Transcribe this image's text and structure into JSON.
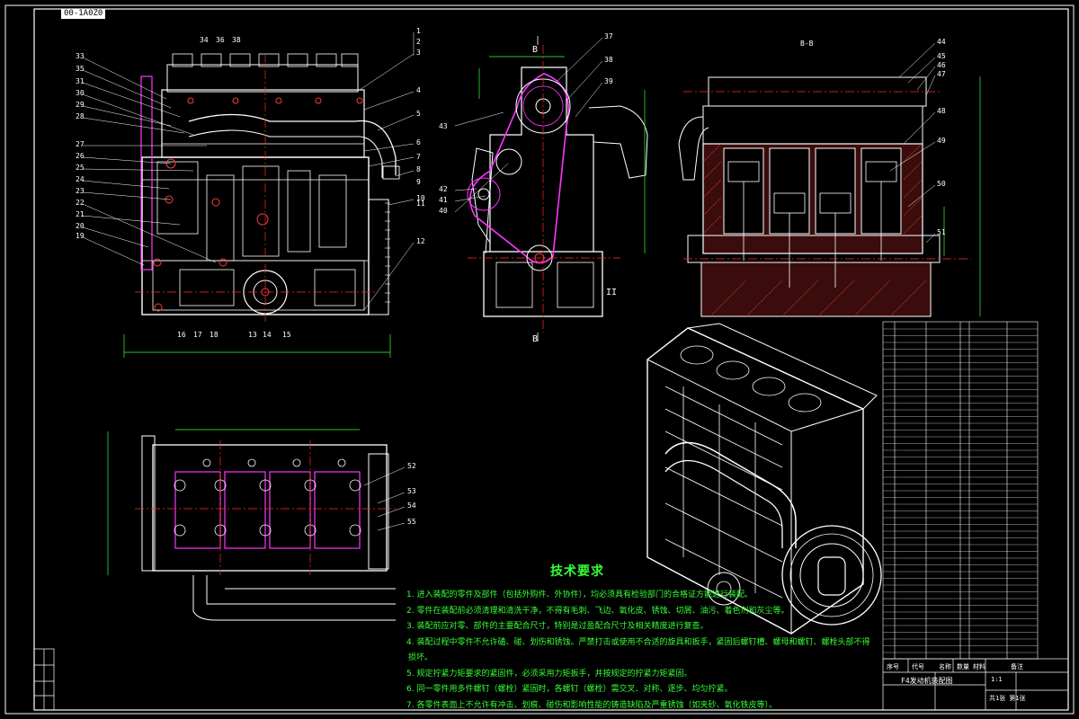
{
  "drawing_stamp": "00-1A0Z0",
  "section_label": "B-B",
  "view_markers": {
    "b_top": "B",
    "b_bottom": "B",
    "side_mark": "II"
  },
  "front_view_callouts_left": [
    "33",
    "35",
    "31",
    "30",
    "29",
    "28",
    "27",
    "26",
    "25",
    "24",
    "23",
    "22",
    "21",
    "20",
    "19"
  ],
  "front_view_callouts_top": [
    "34",
    "36",
    "38"
  ],
  "front_view_callouts_right": [
    "1",
    "2",
    "3",
    "4",
    "5",
    "6",
    "7",
    "8",
    "9",
    "10",
    "11",
    "12"
  ],
  "front_view_callouts_bottom": [
    "16",
    "17",
    "18",
    "13",
    "14",
    "15"
  ],
  "side_view_callouts": [
    "37",
    "38",
    "39",
    "43",
    "42",
    "41",
    "40"
  ],
  "section_view_callouts": [
    "44",
    "45",
    "46",
    "47",
    "48",
    "49",
    "50",
    "51"
  ],
  "bottom_view_callouts": [
    "52",
    "53",
    "54",
    "55"
  ],
  "technical_requirements": {
    "title": "技术要求",
    "items": [
      "1. 进入装配的零件及部件（包括外购件、外协件），均必须具有检验部门的合格证方能进行装配。",
      "2. 零件在装配前必须清理和清洗干净，不得有毛刺、飞边、氧化皮、锈蚀、切屑、油污、着色剂和灰尘等。",
      "3. 装配前应对零、部件的主要配合尺寸，特别是过盈配合尺寸及相关精度进行复查。",
      "4. 装配过程中零件不允许磕、碰、划伤和锈蚀。严禁打击或使用不合适的旋具和扳手，紧固后螺钉槽、螺母和螺钉、螺栓头部不得",
      "损坏。",
      "5. 规定拧紧力矩要求的紧固件，必须采用力矩扳手，并按规定的拧紧力矩紧固。",
      "6. 同一零件用多件螺钉（螺栓）紧固时，各螺钉（螺栓）需交叉、对称、逐步、均匀拧紧。",
      "7. 各零件表面上不允许有冲击、划痕、碰伤和影响性能的铸造缺陷及严重锈蚀（如夹砂、氧化铁皮等）。"
    ]
  },
  "title_block": {
    "name": "F4发动机装配图",
    "scale": "1:1",
    "sheet": "共1张 第1张",
    "headers": [
      "序号",
      "代号",
      "名称",
      "数量",
      "材料",
      "备注"
    ]
  },
  "colors": {
    "background": "#000000",
    "outline": "#ffffff",
    "hatch": "#ff3b3b",
    "centerline": "#ff2a2a",
    "dimension": "#3bff3b",
    "leader": "#ffffff",
    "highlight": "#ff35ff",
    "note_text": "#37ff37"
  }
}
